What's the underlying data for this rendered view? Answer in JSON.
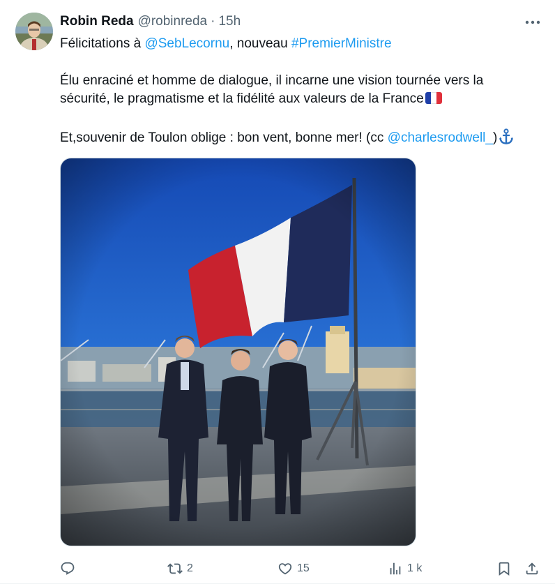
{
  "author": {
    "display_name": "Robin Reda",
    "handle": "@robinreda",
    "separator": "·",
    "time": "15h"
  },
  "tweet": {
    "line1_prefix": "Félicitations à ",
    "mention1": "@SebLecornu",
    "line1_middle": ", nouveau ",
    "hashtag": "#PremierMinistre",
    "line2": "Élu enraciné et homme de dialogue, il incarne une vision tournée vers la",
    "line3": "sécurité, le pragmatisme et la fidélité aux valeurs de la France",
    "line3_emoji": "flag-france-emoji",
    "line4_prefix": "Et,souvenir de Toulon oblige : bon vent, bonne mer! (cc ",
    "mention2": "@charlesrodwell_",
    "line4_suffix": ")",
    "line4_emoji": "anchor-emoji"
  },
  "actions": {
    "reply": {
      "icon": "reply-icon",
      "count": ""
    },
    "retweet": {
      "icon": "retweet-icon",
      "count": "2"
    },
    "like": {
      "icon": "heart-icon",
      "count": "15"
    },
    "views": {
      "icon": "views-icon",
      "count": "1 k"
    },
    "bookmark": {
      "icon": "bookmark-icon"
    },
    "share": {
      "icon": "share-icon"
    }
  },
  "colors": {
    "text": "#0f1419",
    "secondary": "#536471",
    "link": "#1d9bf0",
    "flag_blue": "#1f2b5a",
    "flag_white": "#f4f4f4",
    "flag_red": "#c8222e",
    "sky": "#1e59c8"
  }
}
